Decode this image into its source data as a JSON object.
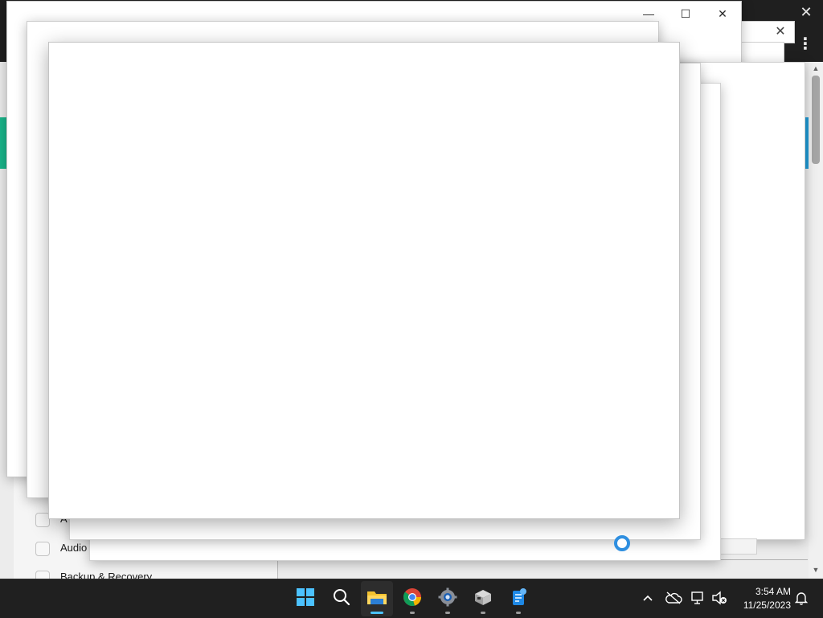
{
  "background_app": {
    "settings_items": [
      {
        "label": "A"
      },
      {
        "label": "Audio"
      },
      {
        "label": "Backup & Recovery"
      }
    ]
  },
  "window_controls": {
    "minimize_icon": "minimize-icon",
    "maximize_icon": "maximize-icon",
    "close_icon": "close-icon"
  },
  "taskbar": {
    "apps": [
      {
        "name": "start",
        "icon": "windows-logo"
      },
      {
        "name": "search",
        "icon": "search-icon"
      },
      {
        "name": "file-explorer",
        "icon": "folder-icon",
        "active": true
      },
      {
        "name": "chrome",
        "icon": "chrome-icon"
      },
      {
        "name": "settings",
        "icon": "gear-icon"
      },
      {
        "name": "app-5",
        "icon": "box-app-icon"
      },
      {
        "name": "app-6",
        "icon": "blue-app-icon"
      }
    ],
    "clock": {
      "time": "3:54 AM",
      "date": "11/25/2023"
    }
  },
  "colors": {
    "taskbar_bg": "#202020",
    "accent_blue": "#4cc2ff",
    "spinner": "#2f8fe0",
    "accent_green": "#19b58a"
  }
}
